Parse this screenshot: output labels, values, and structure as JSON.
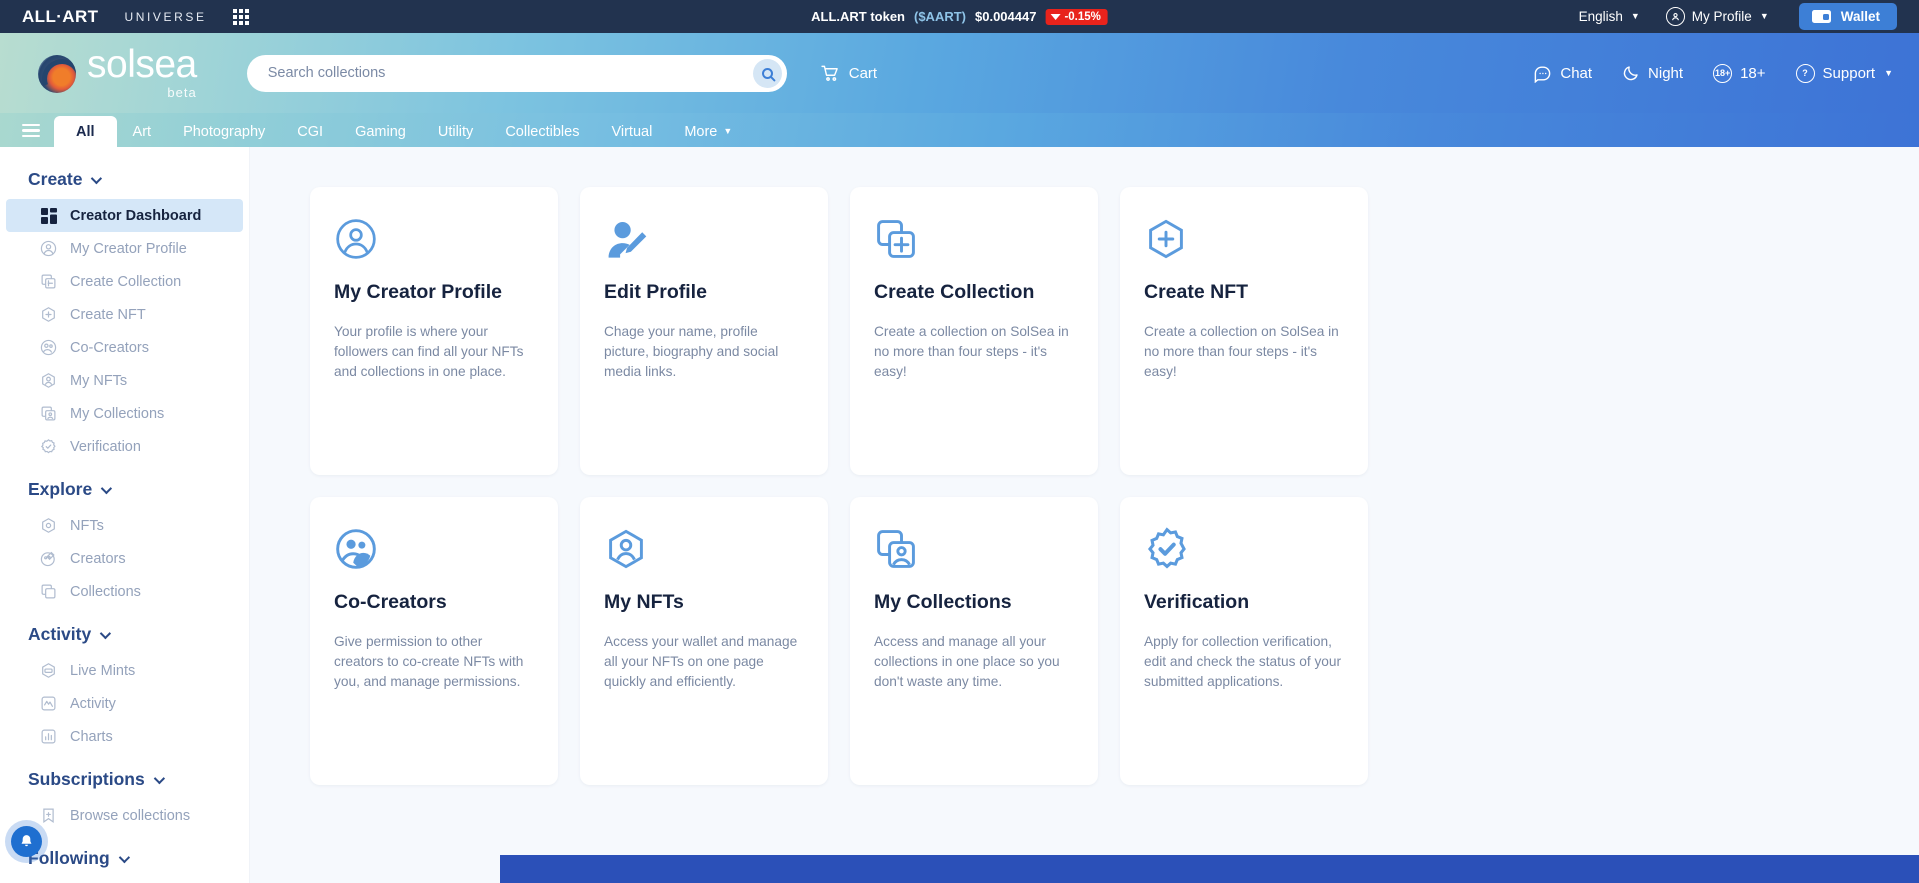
{
  "topbar": {
    "brand": "ALL·ART",
    "universe": "UNIVERSE",
    "apps_icon": "grid-apps-icon",
    "token_label": "ALL.ART token",
    "token_symbol": "($AART)",
    "token_price": "$0.004447",
    "token_change": "-0.15%",
    "token_change_color": "#e8231c",
    "language": "English",
    "profile": "My Profile",
    "wallet": "Wallet"
  },
  "header": {
    "logo_text": "solsea",
    "logo_beta": "beta",
    "search_placeholder": "Search collections",
    "search_value": "",
    "cart": "Cart",
    "chat": "Chat",
    "night": "Night",
    "adult": "18+",
    "support": "Support"
  },
  "nav": {
    "tabs": [
      {
        "label": "All",
        "active": true
      },
      {
        "label": "Art",
        "active": false
      },
      {
        "label": "Photography",
        "active": false
      },
      {
        "label": "CGI",
        "active": false
      },
      {
        "label": "Gaming",
        "active": false
      },
      {
        "label": "Utility",
        "active": false
      },
      {
        "label": "Collectibles",
        "active": false
      },
      {
        "label": "Virtual",
        "active": false
      },
      {
        "label": "More",
        "active": false
      }
    ]
  },
  "sidebar": {
    "groups": [
      {
        "title": "Create",
        "items": [
          {
            "label": "Creator Dashboard",
            "icon": "dashboard-grid-icon",
            "active": true
          },
          {
            "label": "My Creator Profile",
            "icon": "user-circle-icon",
            "active": false
          },
          {
            "label": "Create Collection",
            "icon": "collection-plus-icon",
            "active": false
          },
          {
            "label": "Create NFT",
            "icon": "hexagon-plus-icon",
            "active": false
          },
          {
            "label": "Co-Creators",
            "icon": "co-creators-icon",
            "active": false
          },
          {
            "label": "My NFTs",
            "icon": "hexagon-user-icon",
            "active": false
          },
          {
            "label": "My Collections",
            "icon": "collections-user-icon",
            "active": false
          },
          {
            "label": "Verification",
            "icon": "verified-badge-icon",
            "active": false
          }
        ]
      },
      {
        "title": "Explore",
        "items": [
          {
            "label": "NFTs",
            "icon": "hexagon-icon",
            "active": false
          },
          {
            "label": "Creators",
            "icon": "creators-icon",
            "active": false
          },
          {
            "label": "Collections",
            "icon": "stacked-squares-icon",
            "active": false
          }
        ]
      },
      {
        "title": "Activity",
        "items": [
          {
            "label": "Live Mints",
            "icon": "live-mints-icon",
            "active": false
          },
          {
            "label": "Activity",
            "icon": "activity-pulse-icon",
            "active": false
          },
          {
            "label": "Charts",
            "icon": "bar-chart-icon",
            "active": false
          }
        ]
      },
      {
        "title": "Subscriptions",
        "items": [
          {
            "label": "Browse collections",
            "icon": "bookmark-plus-icon",
            "active": false
          }
        ]
      },
      {
        "title": "Following",
        "items": []
      }
    ]
  },
  "main": {
    "cards": [
      {
        "title": "My Creator Profile",
        "desc": "Your profile is where your followers can find all your NFTs and collections in one place.",
        "icon": "user-circle-icon"
      },
      {
        "title": "Edit Profile",
        "desc": "Chage your name, profile picture, biography and social media links.",
        "icon": "user-edit-icon"
      },
      {
        "title": "Create Collection",
        "desc": "Create a collection on SolSea in no more than four steps - it's easy!",
        "icon": "collection-plus-icon"
      },
      {
        "title": "Create NFT",
        "desc": "Create a collection on SolSea in no more than four steps - it's easy!",
        "icon": "hexagon-plus-icon"
      },
      {
        "title": "Co-Creators",
        "desc": "Give permission to other creators to co-create NFTs with you, and manage permissions.",
        "icon": "co-creators-icon"
      },
      {
        "title": "My NFTs",
        "desc": "Access your wallet and manage all your NFTs on one page quickly and efficiently.",
        "icon": "hexagon-user-icon"
      },
      {
        "title": "My Collections",
        "desc": "Access and manage all your collections in one place so you don't waste any time.",
        "icon": "collections-user-icon"
      },
      {
        "title": "Verification",
        "desc": "Apply for collection verification, edit and check the status of your submitted applications.",
        "icon": "verified-badge-icon"
      }
    ]
  },
  "notification": {
    "icon": "bell-icon"
  },
  "colors": {
    "accent_blue": "#3d7fd6",
    "topbar_navy": "#22334f",
    "sidebar_active_bg": "#d5e7f8",
    "heading_navy": "#16233f",
    "footer_blue": "#2b50b8"
  }
}
